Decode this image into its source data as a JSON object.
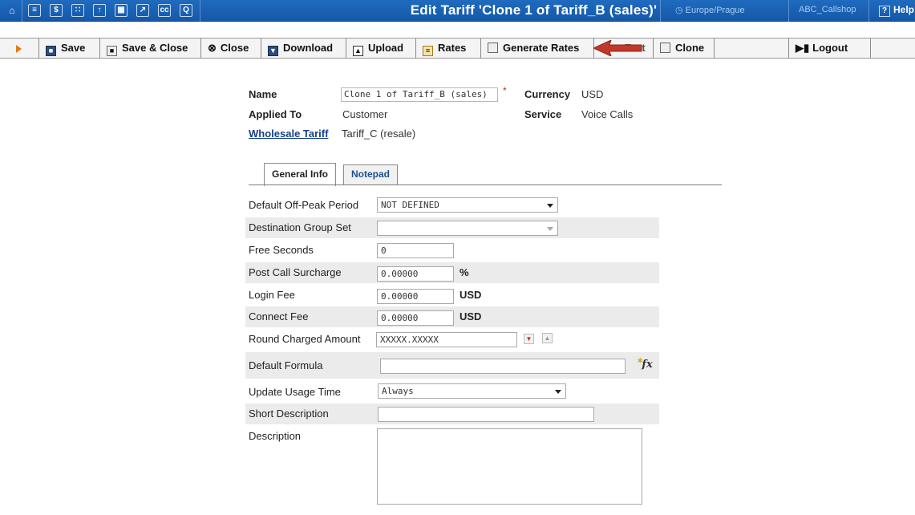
{
  "header": {
    "title": "Edit Tariff 'Clone 1 of Tariff_B (sales)'",
    "timezone": "Europe/Prague",
    "user": "ABC_Callshop",
    "help": "Help",
    "nav_icons": [
      "home-icon",
      "list-icon",
      "dollar-icon",
      "grid-icon",
      "person-icon",
      "modules-icon",
      "chart-icon",
      "cc-icon",
      "search-icon"
    ]
  },
  "toolbar": {
    "save": "Save",
    "save_close": "Save & Close",
    "close": "Close",
    "download": "Download",
    "upload": "Upload",
    "rates": "Rates",
    "generate_rates": "Generate Rates",
    "test": "Test",
    "clone": "Clone",
    "logout": "Logout"
  },
  "tariff": {
    "name_label": "Name",
    "name_value": "Clone 1 of Tariff_B (sales)",
    "required_mark": "*",
    "currency_label": "Currency",
    "currency_value": "USD",
    "applied_to_label": "Applied To",
    "applied_to_value": "Customer",
    "service_label": "Service",
    "service_value": "Voice Calls",
    "wholesale_label": "Wholesale Tariff",
    "wholesale_value": "Tariff_C (resale)"
  },
  "tabs": {
    "general": "General Info",
    "notepad": "Notepad"
  },
  "form": {
    "off_peak_label": "Default Off-Peak Period",
    "off_peak_value": "NOT DEFINED",
    "dest_group_label": "Destination Group Set",
    "dest_group_value": "",
    "free_seconds_label": "Free Seconds",
    "free_seconds_value": "0",
    "post_call_label": "Post Call Surcharge",
    "post_call_value": "0.00000",
    "post_call_unit": "%",
    "login_fee_label": "Login Fee",
    "login_fee_value": "0.00000",
    "login_fee_unit": "USD",
    "connect_fee_label": "Connect Fee",
    "connect_fee_value": "0.00000",
    "connect_fee_unit": "USD",
    "round_label": "Round Charged Amount",
    "round_value": "XXXXX.XXXXX",
    "formula_label": "Default Formula",
    "formula_value": "",
    "update_usage_label": "Update Usage Time",
    "update_usage_value": "Always",
    "short_desc_label": "Short Description",
    "short_desc_value": "",
    "description_label": "Description",
    "description_value": ""
  },
  "colors": {
    "topbar": "#1558a8",
    "link": "#16418a",
    "required": "#d0281c",
    "arrow_annotation": "#c0392b"
  }
}
